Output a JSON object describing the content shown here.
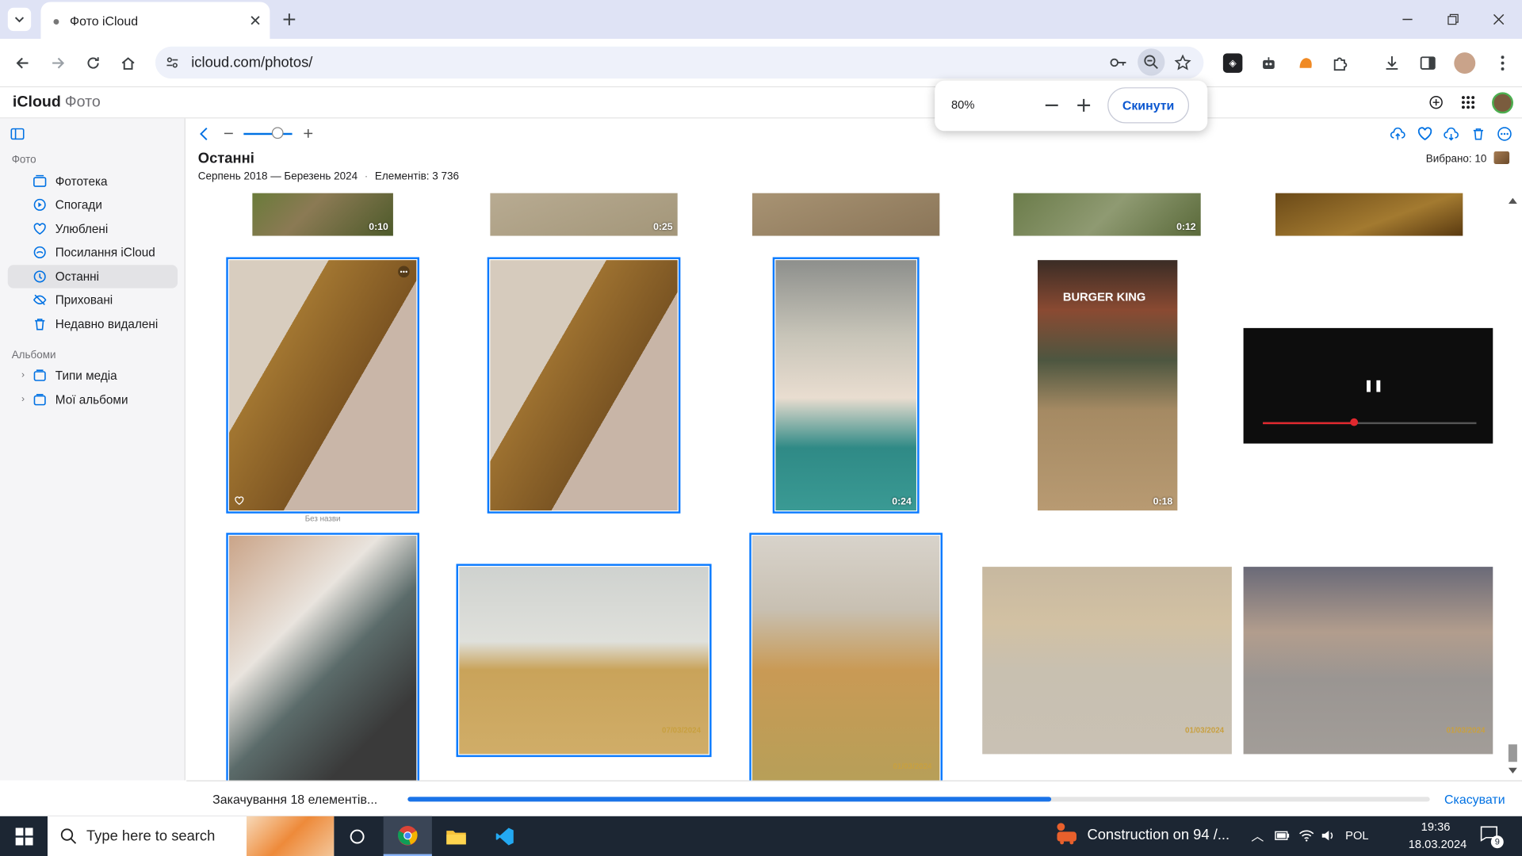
{
  "browser": {
    "tab_title": "Фото iCloud",
    "url": "icloud.com/photos/"
  },
  "app": {
    "brand": "iCloud",
    "brand_section": "Фото"
  },
  "zoom_popup": {
    "level": "80%",
    "reset_label": "Скинути"
  },
  "sidebar": {
    "section_photos": "Фото",
    "items": [
      {
        "label": "Фототека",
        "icon": "library-icon"
      },
      {
        "label": "Спогади",
        "icon": "memories-icon"
      },
      {
        "label": "Улюблені",
        "icon": "heart-icon"
      },
      {
        "label": "Посилання iCloud",
        "icon": "cloud-link-icon"
      },
      {
        "label": "Останні",
        "icon": "clock-icon",
        "active": true
      },
      {
        "label": "Приховані",
        "icon": "eye-slash-icon"
      },
      {
        "label": "Недавно видалені",
        "icon": "trash-icon"
      }
    ],
    "section_albums": "Альбоми",
    "albums": [
      {
        "label": "Типи медіа"
      },
      {
        "label": "Мої альбоми"
      }
    ]
  },
  "main": {
    "title": "Останні",
    "date_range": "Серпень 2018 — Березень 2024",
    "separator": "·",
    "count": "Елементів: 3 736",
    "selected": "Вибрано: 10"
  },
  "grid": {
    "row1_durations": [
      "0:10",
      "0:25",
      "",
      "0:12",
      ""
    ],
    "row2_durations": [
      "",
      "",
      "0:24",
      "0:18",
      ""
    ],
    "row2_caption": "Без назви",
    "row3_dates": [
      "",
      "07/03/2024",
      "01/03/2024",
      "01/03/2024",
      "01/03/2024"
    ],
    "burger_sign": "BURGER KING"
  },
  "status": {
    "text": "Закачування 18 елементів...",
    "progress": 0.63,
    "cancel": "Скасувати"
  },
  "taskbar": {
    "search_placeholder": "Type here to search",
    "weather": "Construction on 94 /...",
    "lang": "POL",
    "time": "19:36",
    "date": "18.03.2024",
    "notifications": "9"
  },
  "colors": {
    "accent": "#0a7aff",
    "sidebar_bg": "#f5f5f7",
    "taskbar_bg": "#1c2633",
    "progress": "#1a73e8"
  }
}
